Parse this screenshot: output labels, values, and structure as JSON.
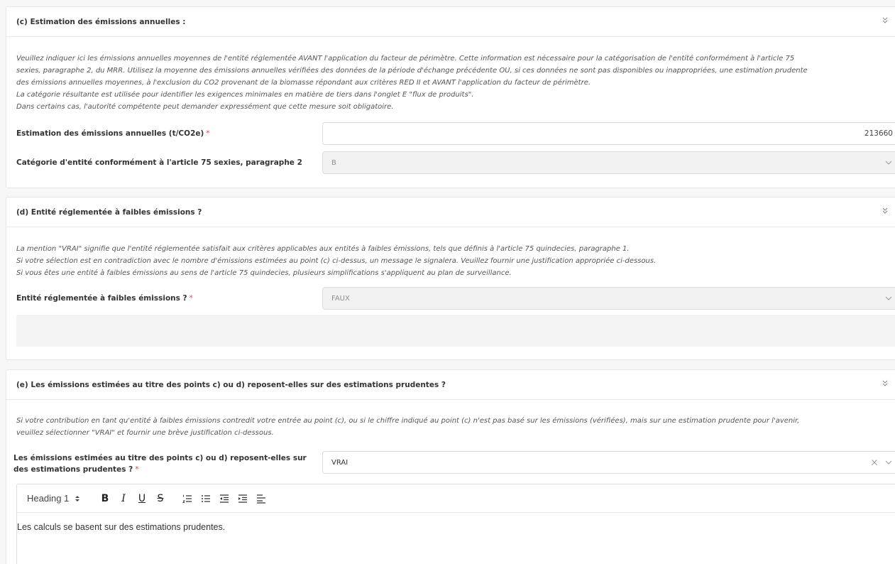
{
  "section_c": {
    "title": "(c)  Estimation des émissions annuelles :",
    "description": "Veuillez indiquer ici les émissions annuelles moyennes de l'entité réglementée AVANT l'application du facteur de périmètre. Cette information est nécessaire pour la catégorisation de l'entité conformément à l'article 75\nsexies, paragraphe 2, du MRR. Utilisez la moyenne des émissions annuelles vérifiées des données de la période d'échange précédente OU, si ces données ne sont pas disponibles ou inappropriées, une estimation prudente\ndes émissions annuelles moyennes, à l'exclusion du CO2 provenant de la biomasse répondant aux critères RED II et AVANT l'application du facteur de périmètre.\nLa catégorie résultante est utilisée pour identifier les exigences minimales en matière de tiers dans l'onglet E \"flux de produits\".\nDans certains cas, l'autorité compétente peut demander expressément que cette mesure soit obligatoire.",
    "estimation_label": "Estimation des émissions annuelles (t/CO2e)",
    "estimation_value": "213660",
    "category_label": "Catégorie d'entité conformément à l'article 75 sexies, paragraphe 2",
    "category_value": "B"
  },
  "section_d": {
    "title": "(d)  Entité réglementée à faibles émissions ?",
    "description": "La mention \"VRAI\" signifie que l'entité réglementée satisfait aux critères applicables aux entités à faibles émissions, tels que définis à l'article 75 quindecies, paragraphe 1.\nSi votre sélection est en contradiction avec le nombre d'émissions estimées au point (c) ci-dessus, un message le signalera. Veuillez fournir une justification appropriée ci-dessous.\nSi vous êtes une entité à faibles émissions au sens de l'article 75 quindecies, plusieurs simplifications s'appliquent au plan de surveillance.",
    "low_emission_label": "Entité réglementée à faibles émissions ?",
    "low_emission_value": "FAUX"
  },
  "section_e": {
    "title": "(e)  Les émissions estimées au titre des points c) ou d) reposent-elles sur des estimations prudentes ?",
    "description": "Si votre contribution en tant qu'entité à faibles émissions contredit votre entrée au point (c), ou si le chiffre indiqué au point (c) n'est pas basé sur les émissions (vérifiées), mais sur une estimation prudente pour l'avenir,\nveuillez sélectionner \"VRAI\" et fournir une brève justification ci-dessous.",
    "conservative_label": "Les émissions estimées au titre des points c) ou d) reposent-elles sur des estimations prudentes ?",
    "conservative_value": "VRAI",
    "editor": {
      "heading_select": "Heading 1",
      "bold": "B",
      "italic": "I",
      "underline": "U",
      "strike": "S",
      "content": "Les calculs se basent sur des estimations prudentes."
    }
  },
  "required_marker": "*",
  "icons": [
    "chevrons-down-icon",
    "chevron-down-icon",
    "clear-x-icon",
    "ordered-list-icon",
    "bullet-list-icon",
    "outdent-icon",
    "indent-icon",
    "align-icon",
    "updown-icon"
  ],
  "colors": {
    "required": "#d9534f",
    "disabled_bg": "#f2f2f3",
    "border": "#d9dbe0"
  }
}
